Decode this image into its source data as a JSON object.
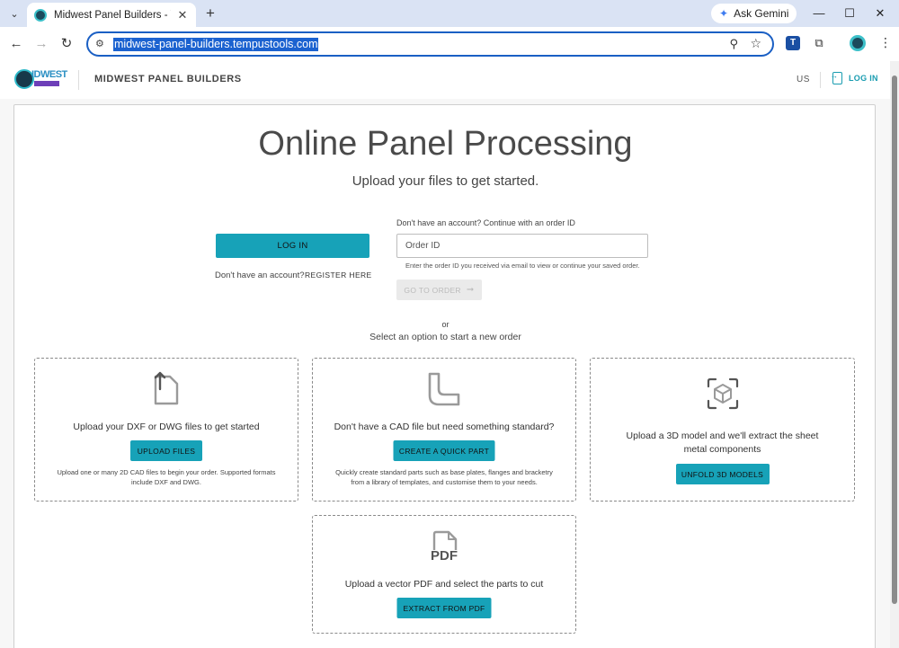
{
  "browser": {
    "tab_title": "Midwest Panel Builders - Web S",
    "gemini_label": "Ask Gemini",
    "url": "midwest-panel-builders.tempustools.com"
  },
  "header": {
    "brand_name": "MIDWEST PANEL BUILDERS",
    "region": "US",
    "login_label": "LOG IN"
  },
  "hero": {
    "title": "Online Panel Processing",
    "subtitle": "Upload your files to get started."
  },
  "auth": {
    "login_button": "LOG IN",
    "no_account_text": "Don't have an account?",
    "register_link": "REGISTER HERE",
    "order_heading": "Don't have an account? Continue with an order ID",
    "order_placeholder": "Order ID",
    "order_help": "Enter the order ID you received via email to view or continue your saved order.",
    "go_to_order": "GO TO ORDER"
  },
  "divider": {
    "or": "or",
    "select_text": "Select an option to start a new order"
  },
  "options": [
    {
      "icon": "upload-file-icon",
      "title": "Upload your DXF or DWG files to get started",
      "button": "UPLOAD FILES",
      "description": "Upload one or many 2D CAD files to begin your order. Supported formats include DXF and DWG."
    },
    {
      "icon": "l-bracket-icon",
      "title": "Don't have a CAD file but need something standard?",
      "button": "CREATE A QUICK PART",
      "description": "Quickly create standard parts such as base plates, flanges and bracketry from a library of templates, and customise them to your needs."
    },
    {
      "icon": "3d-cube-icon",
      "title": "Upload a 3D model and we'll extract the sheet metal components",
      "button": "UNFOLD 3D MODELS",
      "description": ""
    },
    {
      "icon": "pdf-file-icon",
      "icon_label": "PDF",
      "title": "Upload a vector PDF and select the parts to cut",
      "button": "EXTRACT FROM PDF",
      "description": ""
    }
  ],
  "colors": {
    "accent": "#17a2b8",
    "omnibox_focus": "#1a5fc4"
  }
}
